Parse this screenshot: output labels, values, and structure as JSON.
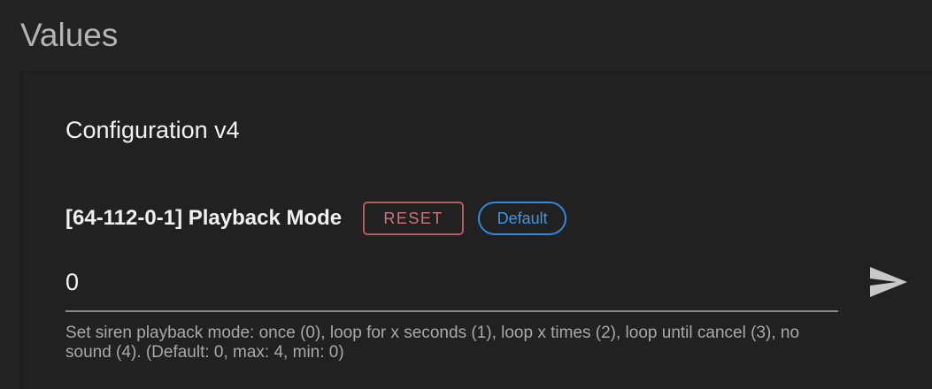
{
  "section": {
    "title": "Values"
  },
  "group": {
    "title": "Configuration v4"
  },
  "value": {
    "label": "[64-112-0-1] Playback Mode",
    "reset_label": "RESET",
    "default_badge": "Default",
    "input_value": "0",
    "help_text": "Set siren playback mode: once (0), loop for x seconds (1), loop x times (2), loop until cancel (3), no sound (4). (Default: 0, max: 4, min: 0)",
    "send_icon": "send-icon"
  },
  "colors": {
    "background": "#232323",
    "reset": "#c8777d",
    "default": "#3b97ec",
    "text": "#f0f0f0",
    "muted": "#a9a9a9"
  }
}
